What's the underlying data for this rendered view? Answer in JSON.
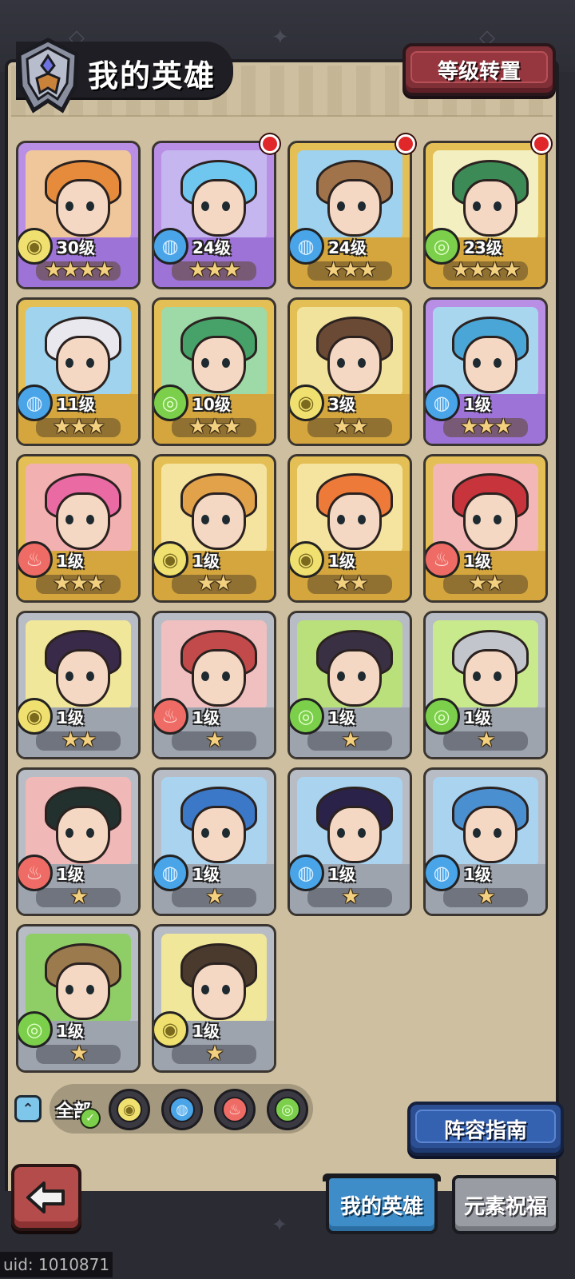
{
  "header": {
    "title": "我的英雄",
    "reset_button": "等级转置"
  },
  "heroes": [
    {
      "level": "30级",
      "stars": "★★★★",
      "element": "earth",
      "frame": "purple",
      "badge": false,
      "hair": "#e58b3b",
      "bg": "#f0c79a"
    },
    {
      "level": "24级",
      "stars": "★★★",
      "element": "water",
      "frame": "purple",
      "badge": true,
      "hair": "#6fc6ef",
      "bg": "#c5b6f0"
    },
    {
      "level": "24级",
      "stars": "★★★",
      "element": "water",
      "frame": "gold",
      "badge": true,
      "hair": "#a0734a",
      "bg": "#9ed2ee"
    },
    {
      "level": "23级",
      "stars": "★★★★",
      "element": "wind",
      "frame": "gold",
      "badge": true,
      "hair": "#3c8a56",
      "bg": "#f3efc1"
    },
    {
      "level": "11级",
      "stars": "★★★",
      "element": "water",
      "frame": "gold",
      "badge": false,
      "hair": "#e8e8ee",
      "bg": "#9fd3ee"
    },
    {
      "level": "10级",
      "stars": "★★★",
      "element": "wind",
      "frame": "gold",
      "badge": false,
      "hair": "#47a26a",
      "bg": "#9edaa8"
    },
    {
      "level": "3级",
      "stars": "★★",
      "element": "earth",
      "frame": "gold",
      "badge": false,
      "hair": "#6a4a34",
      "bg": "#f1e39b"
    },
    {
      "level": "1级",
      "stars": "★★★",
      "element": "water",
      "frame": "purple",
      "badge": false,
      "hair": "#4aa6d6",
      "bg": "#a9d6ef"
    },
    {
      "level": "1级",
      "stars": "★★★",
      "element": "fire",
      "frame": "gold",
      "badge": false,
      "hair": "#ea6aa4",
      "bg": "#f3b0b0"
    },
    {
      "level": "1级",
      "stars": "★★",
      "element": "earth",
      "frame": "gold",
      "badge": false,
      "hair": "#e2a24a",
      "bg": "#f5e4a0"
    },
    {
      "level": "1级",
      "stars": "★★",
      "element": "earth",
      "frame": "gold",
      "badge": false,
      "hair": "#ee7a3a",
      "bg": "#f5e4a0"
    },
    {
      "level": "1级",
      "stars": "★★",
      "element": "fire",
      "frame": "gold",
      "badge": false,
      "hair": "#c8343c",
      "bg": "#f3b7b7"
    },
    {
      "level": "1级",
      "stars": "★★",
      "element": "earth",
      "frame": "silver",
      "badge": false,
      "hair": "#3a2a4a",
      "bg": "#f1e79a"
    },
    {
      "level": "1级",
      "stars": "★",
      "element": "fire",
      "frame": "silver",
      "badge": false,
      "hair": "#c24a4a",
      "bg": "#f0c0c0"
    },
    {
      "level": "1级",
      "stars": "★",
      "element": "wind",
      "frame": "silver",
      "badge": false,
      "hair": "#3a3044",
      "bg": "#b9e07a"
    },
    {
      "level": "1级",
      "stars": "★",
      "element": "wind",
      "frame": "silver",
      "badge": false,
      "hair": "#c2c6cc",
      "bg": "#c8ea8c"
    },
    {
      "level": "1级",
      "stars": "★",
      "element": "fire",
      "frame": "silver",
      "badge": false,
      "hair": "#22302e",
      "bg": "#f1b8b8"
    },
    {
      "level": "1级",
      "stars": "★",
      "element": "water",
      "frame": "silver",
      "badge": false,
      "hair": "#3b78c8",
      "bg": "#a9d3ef"
    },
    {
      "level": "1级",
      "stars": "★",
      "element": "water",
      "frame": "silver",
      "badge": false,
      "hair": "#2a2248",
      "bg": "#a9d3ef"
    },
    {
      "level": "1级",
      "stars": "★",
      "element": "water",
      "frame": "silver",
      "badge": false,
      "hair": "#4a8fd0",
      "bg": "#a9d3ef"
    },
    {
      "level": "1级",
      "stars": "★",
      "element": "wind",
      "frame": "silver",
      "badge": false,
      "hair": "#9b7a4e",
      "bg": "#8fce66"
    },
    {
      "level": "1级",
      "stars": "★",
      "element": "earth",
      "frame": "silver",
      "badge": false,
      "hair": "#4a3a2e",
      "bg": "#f1e79a"
    }
  ],
  "filters": {
    "all_label": "全部",
    "elements": [
      "earth",
      "water",
      "fire",
      "wind"
    ]
  },
  "guide_button": "阵容指南",
  "tabs": {
    "my_heroes": "我的英雄",
    "element_blessing": "元素祝福"
  },
  "uid": "uid: 1010871",
  "colors": {
    "earth": "#efe070",
    "water": "#4aa4e8",
    "fire": "#ef6c66",
    "wind": "#7ccf4b",
    "panel": "#cdbf9f"
  }
}
